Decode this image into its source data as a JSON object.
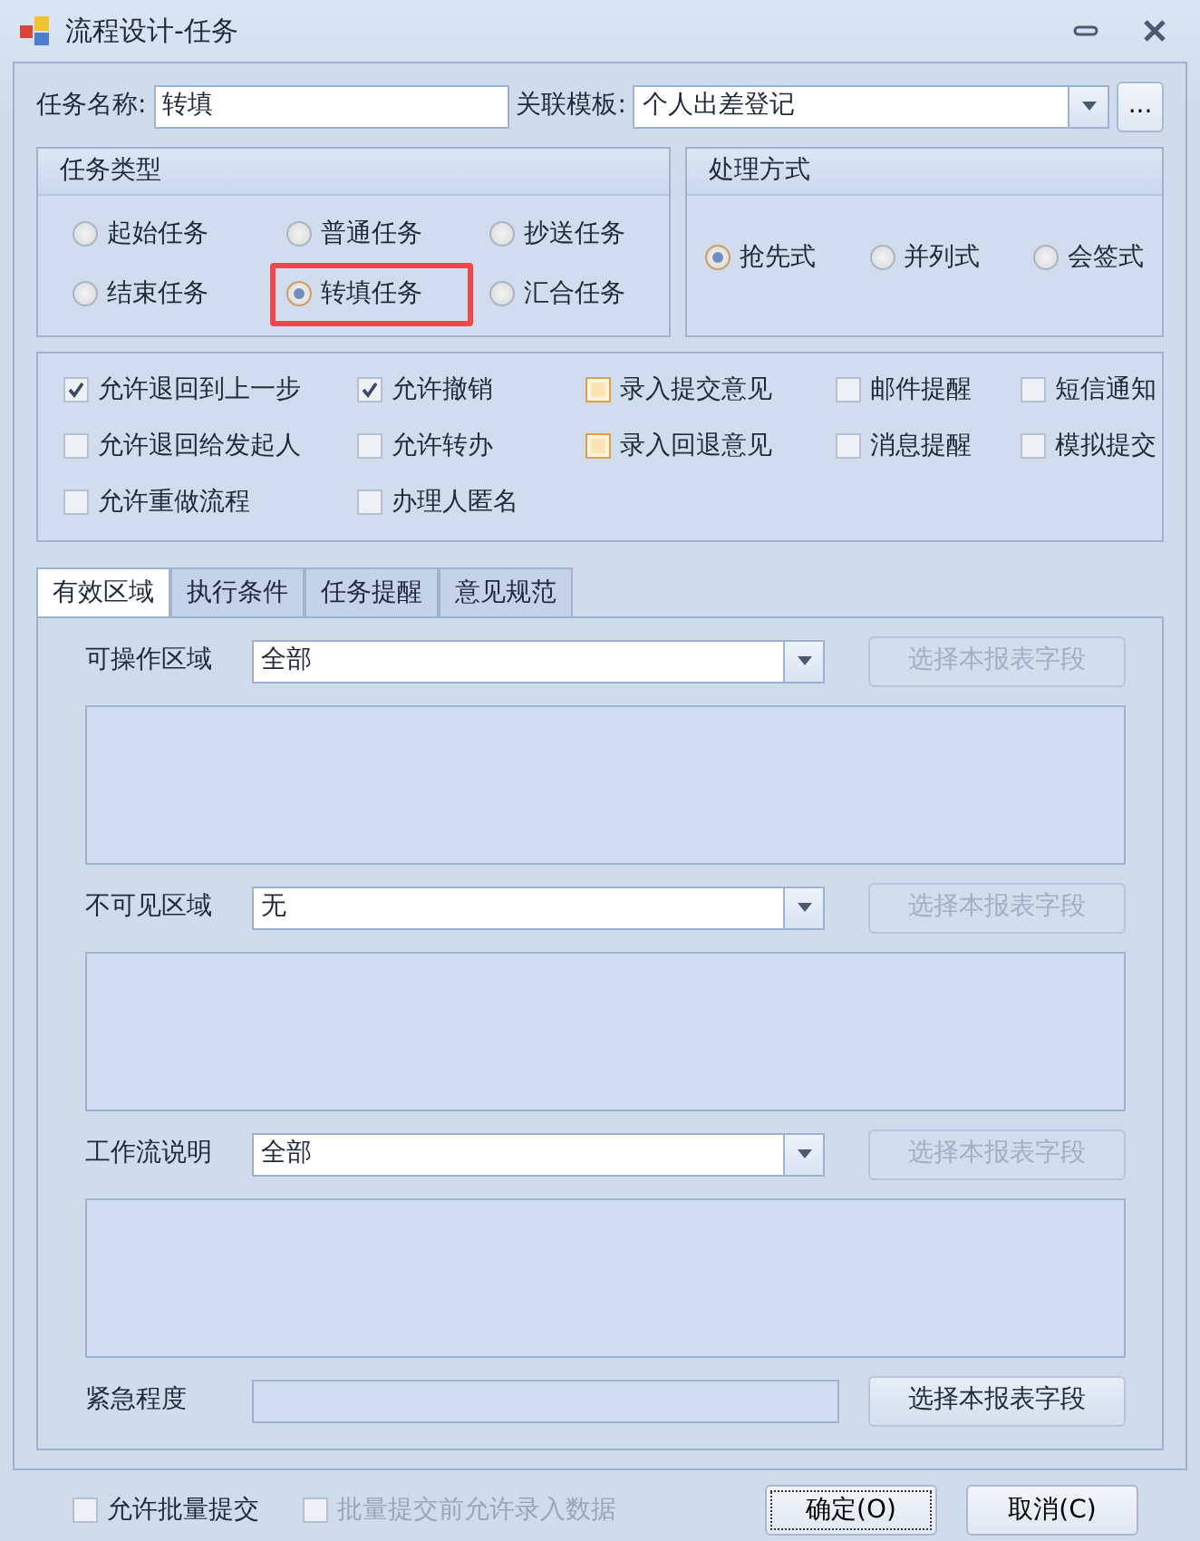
{
  "window": {
    "title": "流程设计-任务"
  },
  "task_name": {
    "label": "任务名称:",
    "value": "转填"
  },
  "template": {
    "label": "关联模板:",
    "value": "个人出差登记",
    "browse": "..."
  },
  "task_type": {
    "title": "任务类型",
    "options": [
      {
        "label": "起始任务",
        "selected": false,
        "highlighted": false
      },
      {
        "label": "普通任务",
        "selected": false,
        "highlighted": false
      },
      {
        "label": "抄送任务",
        "selected": false,
        "highlighted": false
      },
      {
        "label": "结束任务",
        "selected": false,
        "highlighted": false
      },
      {
        "label": "转填任务",
        "selected": true,
        "highlighted": true
      },
      {
        "label": "汇合任务",
        "selected": false,
        "highlighted": false
      }
    ]
  },
  "handling": {
    "title": "处理方式",
    "options": [
      {
        "label": "抢先式",
        "selected": true
      },
      {
        "label": "并列式",
        "selected": false
      },
      {
        "label": "会签式",
        "selected": false
      }
    ]
  },
  "options": [
    {
      "label": "允许退回到上一步",
      "checked": true,
      "emphasized": false
    },
    {
      "label": "允许撤销",
      "checked": true,
      "emphasized": false
    },
    {
      "label": "录入提交意见",
      "checked": false,
      "emphasized": true
    },
    {
      "label": "邮件提醒",
      "checked": false,
      "emphasized": false
    },
    {
      "label": "短信通知",
      "checked": false,
      "emphasized": false
    },
    {
      "label": "允许退回给发起人",
      "checked": false,
      "emphasized": false
    },
    {
      "label": "允许转办",
      "checked": false,
      "emphasized": false
    },
    {
      "label": "录入回退意见",
      "checked": false,
      "emphasized": true
    },
    {
      "label": "消息提醒",
      "checked": false,
      "emphasized": false
    },
    {
      "label": "模拟提交",
      "checked": false,
      "emphasized": false
    },
    {
      "label": "允许重做流程",
      "checked": false,
      "emphasized": false
    },
    {
      "label": "办理人匿名",
      "checked": false,
      "emphasized": false
    }
  ],
  "tabs": [
    {
      "label": "有效区域",
      "selected": true
    },
    {
      "label": "执行条件",
      "selected": false
    },
    {
      "label": "任务提醒",
      "selected": false
    },
    {
      "label": "意见规范",
      "selected": false
    }
  ],
  "sections": [
    {
      "kind": "combo",
      "label": "可操作区域",
      "value": "全部",
      "button": "选择本报表字段",
      "button_disabled": true
    },
    {
      "kind": "combo",
      "label": "不可见区域",
      "value": "无",
      "button": "选择本报表字段",
      "button_disabled": true
    },
    {
      "kind": "combo",
      "label": "工作流说明",
      "value": "全部",
      "button": "选择本报表字段",
      "button_disabled": true
    },
    {
      "kind": "field",
      "label": "紧急程度",
      "button": "选择本报表字段",
      "button_disabled": false
    }
  ],
  "footer": {
    "checks": [
      {
        "label": "允许批量提交",
        "checked": false,
        "disabled": false
      },
      {
        "label": "批量提交前允许录入数据",
        "checked": false,
        "disabled": true
      }
    ],
    "buttons": [
      {
        "label": "确定(O)",
        "focused": true
      },
      {
        "label": "取消(C)",
        "focused": false
      }
    ]
  }
}
